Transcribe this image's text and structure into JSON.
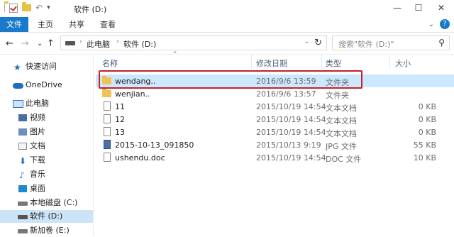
{
  "window": {
    "title": "软件 (D:)",
    "minimize_glyph": "—",
    "maximize_glyph": "☐",
    "close_glyph": "✕",
    "quick_access_arrow": "▾",
    "undo_glyph": "↶"
  },
  "ribbon": {
    "tabs": [
      "文件",
      "主页",
      "共享",
      "查看"
    ],
    "collapse_glyph": "⌄",
    "help_glyph": "?"
  },
  "nav": {
    "back_glyph": "←",
    "forward_glyph": "→",
    "recent_glyph": "⌄",
    "up_glyph": "↑",
    "refresh_glyph": "↻"
  },
  "address": {
    "crumbs": [
      "此电脑",
      "软件 (D:)"
    ],
    "separator": "›",
    "dropdown_glyph": "⌄"
  },
  "search": {
    "placeholder": "搜索\"软件 (D:)\"",
    "icon_glyph": "⚲"
  },
  "sidebar": {
    "items": [
      {
        "label": "快速访问",
        "icon": "star-icon"
      },
      {
        "label": "OneDrive",
        "icon": "cloud-icon"
      },
      {
        "label": "此电脑",
        "icon": "computer-icon"
      },
      {
        "label": "视频",
        "icon": "video-folder-icon"
      },
      {
        "label": "图片",
        "icon": "pictures-folder-icon"
      },
      {
        "label": "文档",
        "icon": "documents-folder-icon"
      },
      {
        "label": "下载",
        "icon": "download-arrow-icon"
      },
      {
        "label": "音乐",
        "icon": "music-note-icon"
      },
      {
        "label": "桌面",
        "icon": "desktop-folder-icon"
      },
      {
        "label": "本地磁盘 (C:)",
        "icon": "drive-icon"
      },
      {
        "label": "软件 (D:)",
        "icon": "drive-icon",
        "selected": true
      },
      {
        "label": "新加卷 (E:)",
        "icon": "drive-icon"
      }
    ],
    "star_glyph": "★",
    "download_glyph": "⬇",
    "music_glyph": "♪"
  },
  "list": {
    "columns": [
      "名称",
      "修改日期",
      "类型",
      "大小"
    ],
    "sort_glyph": "⌃",
    "rows": [
      {
        "name": "wendang..",
        "date": "2016/9/6 13:59",
        "type": "文件夹",
        "size": "",
        "kind": "folder",
        "selected": true
      },
      {
        "name": "wenjian..",
        "date": "2016/9/6 13:57",
        "type": "文件夹",
        "size": "",
        "kind": "folder"
      },
      {
        "name": "11",
        "date": "2015/10/19 14:54",
        "type": "文本文档",
        "size": "0 KB",
        "kind": "txt"
      },
      {
        "name": "12",
        "date": "2015/10/19 14:54",
        "type": "文本文档",
        "size": "0 KB",
        "kind": "txt"
      },
      {
        "name": "13",
        "date": "2015/10/19 14:54",
        "type": "文本文档",
        "size": "0 KB",
        "kind": "txt"
      },
      {
        "name": "2015-10-13_091850",
        "date": "2015/10/13 9:19",
        "type": "JPG 文件",
        "size": "55 KB",
        "kind": "jpg"
      },
      {
        "name": "ushendu.doc",
        "date": "2015/10/19 14:54",
        "type": "DOC 文件",
        "size": "10 KB",
        "kind": "txt"
      }
    ]
  },
  "colors": {
    "accent": "#1979ca",
    "selection": "#cce8ff",
    "highlight_box": "#c8202a"
  }
}
